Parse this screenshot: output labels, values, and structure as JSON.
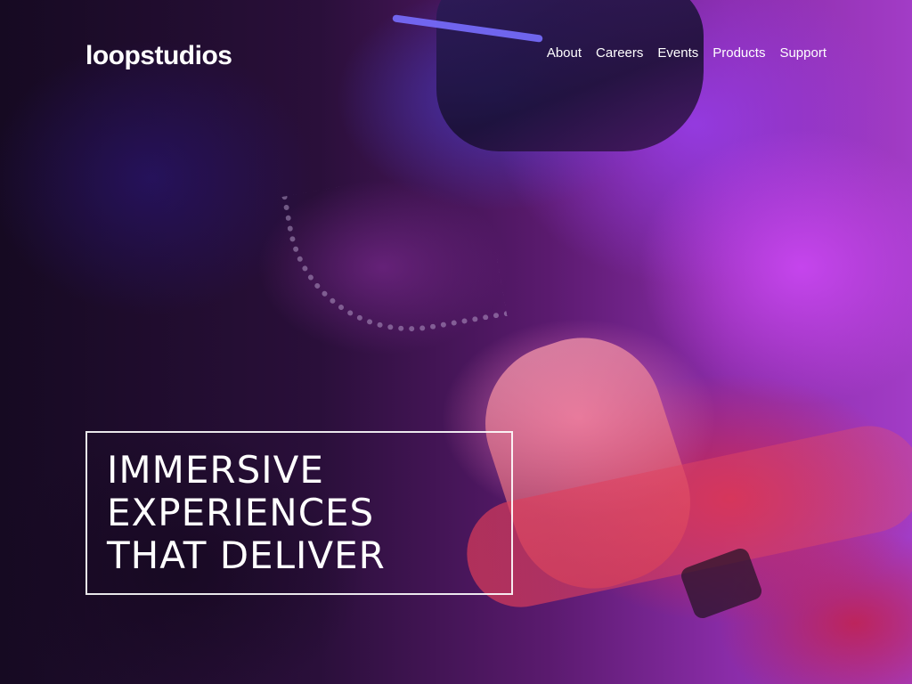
{
  "header": {
    "logo": "loopstudios",
    "nav": [
      "About",
      "Careers",
      "Events",
      "Products",
      "Support"
    ]
  },
  "hero": {
    "headline_lines": [
      "IMMERSIVE",
      "EXPERIENCES",
      "THAT DELIVER"
    ]
  },
  "colors": {
    "text": "#ffffff",
    "box_border": "#ffffff",
    "background_dark": "#160a22",
    "accent_magenta": "#a23cc6",
    "accent_red": "#d72846",
    "accent_blue": "#463cc8"
  }
}
